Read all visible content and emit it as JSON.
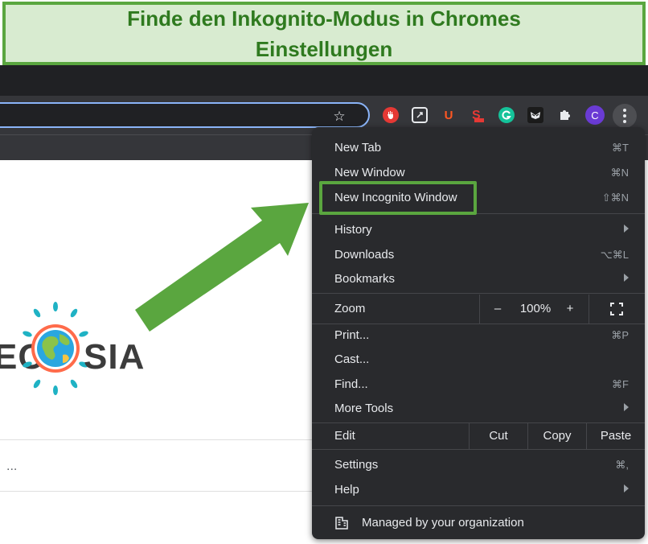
{
  "banner": {
    "title": "Finde den Inkognito-Modus in Chromes Einstellungen"
  },
  "toolbar": {
    "avatar_letter": "C"
  },
  "extensions": [
    "ublock-icon",
    "tab-icon",
    "u-icon",
    "seo-icon",
    "grammarly-icon",
    "mask-icon",
    "puzzle-icon"
  ],
  "logo": {
    "left": "EC",
    "right": "SIA"
  },
  "page": {
    "ellipsis": "..."
  },
  "menu": {
    "new_tab": {
      "label": "New Tab",
      "shortcut": "⌘T"
    },
    "new_window": {
      "label": "New Window",
      "shortcut": "⌘N"
    },
    "new_incognito": {
      "label": "New Incognito Window",
      "shortcut": "⇧⌘N"
    },
    "history": {
      "label": "History"
    },
    "downloads": {
      "label": "Downloads",
      "shortcut": "⌥⌘L"
    },
    "bookmarks": {
      "label": "Bookmarks"
    },
    "zoom": {
      "label": "Zoom",
      "minus": "–",
      "level": "100%",
      "plus": "+"
    },
    "print": {
      "label": "Print...",
      "shortcut": "⌘P"
    },
    "cast": {
      "label": "Cast..."
    },
    "find": {
      "label": "Find...",
      "shortcut": "⌘F"
    },
    "more_tools": {
      "label": "More Tools"
    },
    "edit": {
      "label": "Edit",
      "cut": "Cut",
      "copy": "Copy",
      "paste": "Paste"
    },
    "settings": {
      "label": "Settings",
      "shortcut": "⌘,"
    },
    "help": {
      "label": "Help"
    },
    "managed": {
      "label": "Managed by your organization"
    }
  },
  "colors": {
    "accent_green": "#5aa63f",
    "menu_bg": "#292a2d",
    "toolbar_bg": "#35363a"
  }
}
